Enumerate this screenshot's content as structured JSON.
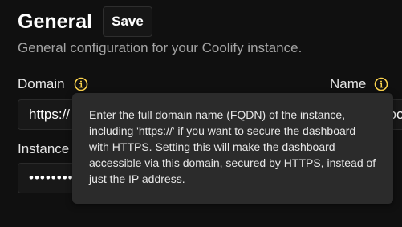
{
  "header": {
    "title": "General",
    "save_label": "Save",
    "subtitle": "General configuration for your Coolify instance."
  },
  "fields": {
    "domain": {
      "label": "Domain",
      "value": "https://"
    },
    "name": {
      "label": "Name",
      "value": "coolify"
    },
    "instance_password": {
      "label": "Instance",
      "value": "••••••••••••••••"
    }
  },
  "tooltip": {
    "text": "Enter the full domain name (FQDN) of the instance, including 'https://' if you want to secure the dashboard with HTTPS. Setting this will make the dashboard accessible via this domain, secured by HTTPS, instead of just the IP address."
  },
  "colors": {
    "background": "#101010",
    "info_icon": "#fcd34d",
    "tooltip_background": "#2b2b2b"
  },
  "icons": {
    "domain_info": "info-icon",
    "name_info": "info-icon"
  }
}
